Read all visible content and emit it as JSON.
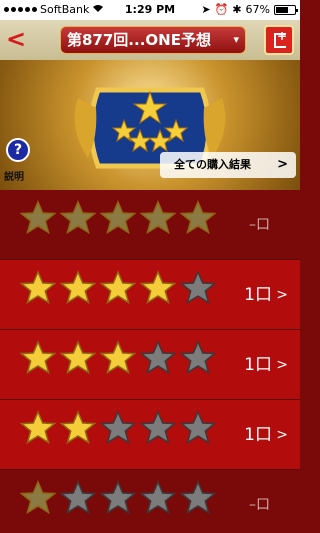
{
  "status": {
    "carrier": "SoftBank",
    "time": "1:29 PM",
    "battery": "67%",
    "battery_level": 0.67
  },
  "nav": {
    "back_label": "<",
    "title": "第877回...ONE予想",
    "caret": "▾"
  },
  "banner": {
    "help_label": "説明",
    "help_glyph": "?",
    "all_results_label": "全ての購入結果",
    "all_results_arrow": ">"
  },
  "rows": [
    {
      "gold": 5,
      "count": "–口",
      "highlight": false
    },
    {
      "gold": 4,
      "count": "1口",
      "highlight": true
    },
    {
      "gold": 3,
      "count": "1口",
      "highlight": true
    },
    {
      "gold": 2,
      "count": "1口",
      "highlight": true
    },
    {
      "gold": 1,
      "count": "–口",
      "highlight": false
    }
  ],
  "colors": {
    "gold_star": "#f5cd3a",
    "gray_star": "#7c7c7c",
    "accent_red": "#b20c0c"
  }
}
